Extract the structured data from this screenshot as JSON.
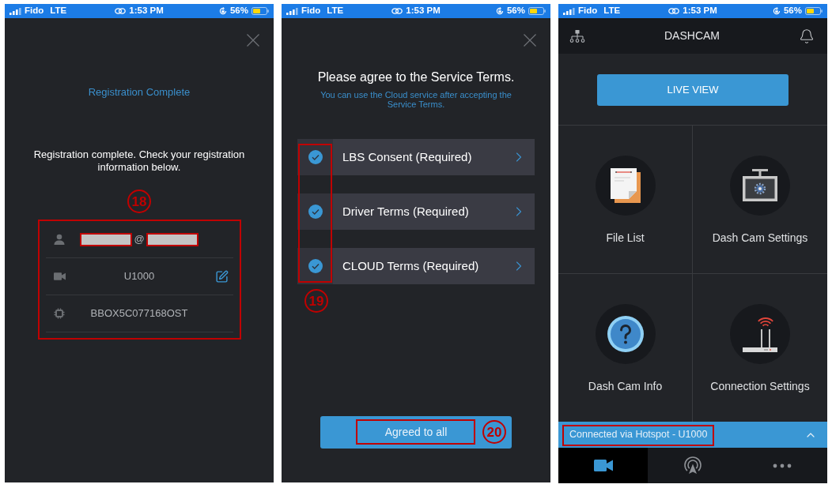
{
  "screens": [
    {
      "kind": "registration",
      "status_bar": {
        "carrier": "Fido",
        "network": "LTE",
        "time": "1:53 PM",
        "battery": "56%"
      },
      "title": "Registration Complete",
      "message": "Registration complete. Check your registration information below.",
      "callout": "18",
      "info_card": {
        "highlighted": true,
        "rows": [
          {
            "kind": "account",
            "value": "@",
            "redacted": true,
            "editable": false
          },
          {
            "kind": "camera",
            "value": "U1000",
            "redacted": false,
            "editable": true
          },
          {
            "kind": "serial",
            "value": "BBOX5C077168OST",
            "redacted": false,
            "editable": false
          }
        ]
      }
    },
    {
      "kind": "terms",
      "status_bar": {
        "carrier": "Fido",
        "network": "LTE",
        "time": "1:53 PM",
        "battery": "56%"
      },
      "heading": "Please agree to the Service Terms.",
      "subheading": "You can use the Cloud service after accepting the Service Terms.",
      "terms": [
        {
          "label": "LBS Consent (Required)",
          "checked": true
        },
        {
          "label": "Driver Terms (Required)",
          "checked": true
        },
        {
          "label": "CLOUD Terms (Required)",
          "checked": true
        }
      ],
      "checkboxes_highlighted": true,
      "checkboxes_callout": "19",
      "agree_button": {
        "label": "Agreed to all",
        "highlighted": true,
        "callout": "20"
      }
    },
    {
      "kind": "dashboard",
      "status_bar": {
        "carrier": "Fido",
        "network": "LTE",
        "time": "1:53 PM",
        "battery": "56%"
      },
      "title": "DASHCAM",
      "live_view_button": "LIVE VIEW",
      "menu": [
        {
          "kind": "files",
          "label": "File List"
        },
        {
          "kind": "camera_settings",
          "label": "Dash Cam Settings"
        },
        {
          "kind": "info",
          "label": "Dash Cam Info"
        },
        {
          "kind": "connection",
          "label": "Connection Settings"
        }
      ],
      "connection_banner": {
        "text": "Connected via Hotspot - U1000",
        "highlighted": true
      },
      "tab_bar": [
        {
          "kind": "camera",
          "selected": true
        },
        {
          "kind": "broadcast",
          "selected": false
        },
        {
          "kind": "more",
          "selected": false
        }
      ]
    }
  ]
}
